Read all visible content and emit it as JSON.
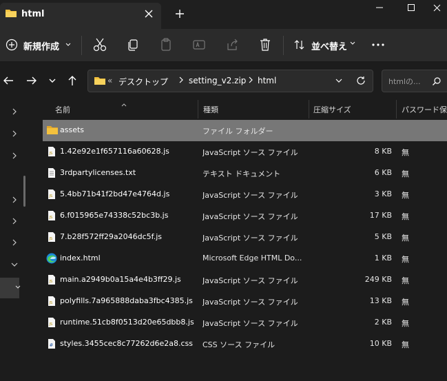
{
  "window": {
    "tab_title": "html",
    "colors": {
      "background": "#1c1c1c",
      "toolbar": "#2b2b2b",
      "selection": "#777777",
      "folder": "#f4c13d"
    }
  },
  "toolbar": {
    "new_label": "新規作成",
    "sort_label": "並べ替え",
    "icons": [
      "cut-icon",
      "copy-icon",
      "paste-icon",
      "rename-icon",
      "share-icon",
      "delete-icon"
    ]
  },
  "address": {
    "overflow": "«",
    "crumbs": [
      "デスクトップ",
      "setting_v2.zip",
      "html"
    ],
    "search_placeholder": "htmlの..."
  },
  "columns": {
    "name": "名前",
    "type": "種類",
    "size": "圧縮サイズ",
    "password": "パスワード保..."
  },
  "files": [
    {
      "name": "assets",
      "type": "ファイル フォルダー",
      "size": "",
      "password": "",
      "icon": "folder"
    },
    {
      "name": "1.42e92e1f657116a60628.js",
      "type": "JavaScript ソース ファイル",
      "size": "8 KB",
      "password": "無",
      "icon": "js"
    },
    {
      "name": "3rdpartylicenses.txt",
      "type": "テキスト ドキュメント",
      "size": "6 KB",
      "password": "無",
      "icon": "txt"
    },
    {
      "name": "5.4bb71b41f2bd47e4764d.js",
      "type": "JavaScript ソース ファイル",
      "size": "3 KB",
      "password": "無",
      "icon": "js"
    },
    {
      "name": "6.f015965e74338c52bc3b.js",
      "type": "JavaScript ソース ファイル",
      "size": "17 KB",
      "password": "無",
      "icon": "js"
    },
    {
      "name": "7.b28f572ff29a2046dc5f.js",
      "type": "JavaScript ソース ファイル",
      "size": "5 KB",
      "password": "無",
      "icon": "js"
    },
    {
      "name": "index.html",
      "type": "Microsoft Edge HTML Do...",
      "size": "1 KB",
      "password": "無",
      "icon": "edge"
    },
    {
      "name": "main.a2949b0a15a4e4b3ff29.js",
      "type": "JavaScript ソース ファイル",
      "size": "249 KB",
      "password": "無",
      "icon": "js"
    },
    {
      "name": "polyfills.7a965888daba3fbc4385.js",
      "type": "JavaScript ソース ファイル",
      "size": "13 KB",
      "password": "無",
      "icon": "js"
    },
    {
      "name": "runtime.51cb8f0513d20e65dbb8.js",
      "type": "JavaScript ソース ファイル",
      "size": "2 KB",
      "password": "無",
      "icon": "js"
    },
    {
      "name": "styles.3455cec8c77262d6e2a8.css",
      "type": "CSS ソース ファイル",
      "size": "10 KB",
      "password": "無",
      "icon": "css"
    }
  ]
}
